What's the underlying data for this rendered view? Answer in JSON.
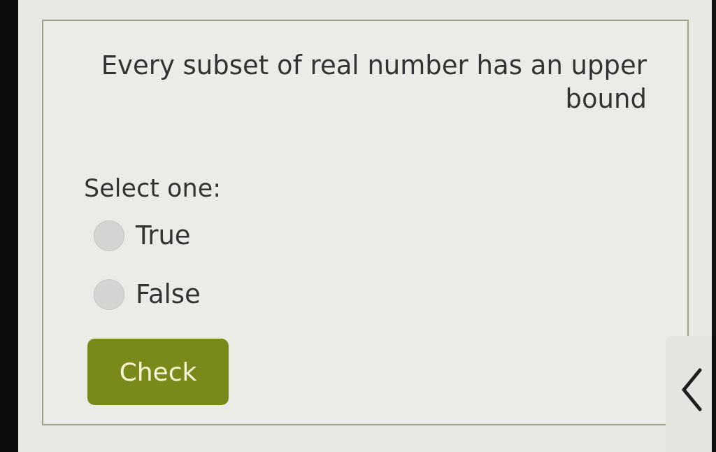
{
  "question": {
    "text": "Every subset of real number has an upper bound"
  },
  "prompt": "Select one:",
  "options": [
    {
      "label": "True",
      "selected": false
    },
    {
      "label": "False",
      "selected": false
    }
  ],
  "check_button": {
    "label": "Check"
  }
}
